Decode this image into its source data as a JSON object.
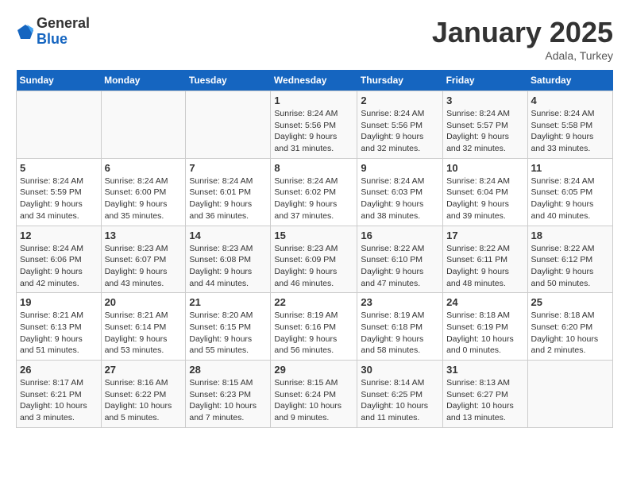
{
  "header": {
    "logo_general": "General",
    "logo_blue": "Blue",
    "month": "January 2025",
    "location": "Adala, Turkey"
  },
  "days_of_week": [
    "Sunday",
    "Monday",
    "Tuesday",
    "Wednesday",
    "Thursday",
    "Friday",
    "Saturday"
  ],
  "weeks": [
    [
      {
        "day": "",
        "info": ""
      },
      {
        "day": "",
        "info": ""
      },
      {
        "day": "",
        "info": ""
      },
      {
        "day": "1",
        "info": "Sunrise: 8:24 AM\nSunset: 5:56 PM\nDaylight: 9 hours\nand 31 minutes."
      },
      {
        "day": "2",
        "info": "Sunrise: 8:24 AM\nSunset: 5:56 PM\nDaylight: 9 hours\nand 32 minutes."
      },
      {
        "day": "3",
        "info": "Sunrise: 8:24 AM\nSunset: 5:57 PM\nDaylight: 9 hours\nand 32 minutes."
      },
      {
        "day": "4",
        "info": "Sunrise: 8:24 AM\nSunset: 5:58 PM\nDaylight: 9 hours\nand 33 minutes."
      }
    ],
    [
      {
        "day": "5",
        "info": "Sunrise: 8:24 AM\nSunset: 5:59 PM\nDaylight: 9 hours\nand 34 minutes."
      },
      {
        "day": "6",
        "info": "Sunrise: 8:24 AM\nSunset: 6:00 PM\nDaylight: 9 hours\nand 35 minutes."
      },
      {
        "day": "7",
        "info": "Sunrise: 8:24 AM\nSunset: 6:01 PM\nDaylight: 9 hours\nand 36 minutes."
      },
      {
        "day": "8",
        "info": "Sunrise: 8:24 AM\nSunset: 6:02 PM\nDaylight: 9 hours\nand 37 minutes."
      },
      {
        "day": "9",
        "info": "Sunrise: 8:24 AM\nSunset: 6:03 PM\nDaylight: 9 hours\nand 38 minutes."
      },
      {
        "day": "10",
        "info": "Sunrise: 8:24 AM\nSunset: 6:04 PM\nDaylight: 9 hours\nand 39 minutes."
      },
      {
        "day": "11",
        "info": "Sunrise: 8:24 AM\nSunset: 6:05 PM\nDaylight: 9 hours\nand 40 minutes."
      }
    ],
    [
      {
        "day": "12",
        "info": "Sunrise: 8:24 AM\nSunset: 6:06 PM\nDaylight: 9 hours\nand 42 minutes."
      },
      {
        "day": "13",
        "info": "Sunrise: 8:23 AM\nSunset: 6:07 PM\nDaylight: 9 hours\nand 43 minutes."
      },
      {
        "day": "14",
        "info": "Sunrise: 8:23 AM\nSunset: 6:08 PM\nDaylight: 9 hours\nand 44 minutes."
      },
      {
        "day": "15",
        "info": "Sunrise: 8:23 AM\nSunset: 6:09 PM\nDaylight: 9 hours\nand 46 minutes."
      },
      {
        "day": "16",
        "info": "Sunrise: 8:22 AM\nSunset: 6:10 PM\nDaylight: 9 hours\nand 47 minutes."
      },
      {
        "day": "17",
        "info": "Sunrise: 8:22 AM\nSunset: 6:11 PM\nDaylight: 9 hours\nand 48 minutes."
      },
      {
        "day": "18",
        "info": "Sunrise: 8:22 AM\nSunset: 6:12 PM\nDaylight: 9 hours\nand 50 minutes."
      }
    ],
    [
      {
        "day": "19",
        "info": "Sunrise: 8:21 AM\nSunset: 6:13 PM\nDaylight: 9 hours\nand 51 minutes."
      },
      {
        "day": "20",
        "info": "Sunrise: 8:21 AM\nSunset: 6:14 PM\nDaylight: 9 hours\nand 53 minutes."
      },
      {
        "day": "21",
        "info": "Sunrise: 8:20 AM\nSunset: 6:15 PM\nDaylight: 9 hours\nand 55 minutes."
      },
      {
        "day": "22",
        "info": "Sunrise: 8:19 AM\nSunset: 6:16 PM\nDaylight: 9 hours\nand 56 minutes."
      },
      {
        "day": "23",
        "info": "Sunrise: 8:19 AM\nSunset: 6:18 PM\nDaylight: 9 hours\nand 58 minutes."
      },
      {
        "day": "24",
        "info": "Sunrise: 8:18 AM\nSunset: 6:19 PM\nDaylight: 10 hours\nand 0 minutes."
      },
      {
        "day": "25",
        "info": "Sunrise: 8:18 AM\nSunset: 6:20 PM\nDaylight: 10 hours\nand 2 minutes."
      }
    ],
    [
      {
        "day": "26",
        "info": "Sunrise: 8:17 AM\nSunset: 6:21 PM\nDaylight: 10 hours\nand 3 minutes."
      },
      {
        "day": "27",
        "info": "Sunrise: 8:16 AM\nSunset: 6:22 PM\nDaylight: 10 hours\nand 5 minutes."
      },
      {
        "day": "28",
        "info": "Sunrise: 8:15 AM\nSunset: 6:23 PM\nDaylight: 10 hours\nand 7 minutes."
      },
      {
        "day": "29",
        "info": "Sunrise: 8:15 AM\nSunset: 6:24 PM\nDaylight: 10 hours\nand 9 minutes."
      },
      {
        "day": "30",
        "info": "Sunrise: 8:14 AM\nSunset: 6:25 PM\nDaylight: 10 hours\nand 11 minutes."
      },
      {
        "day": "31",
        "info": "Sunrise: 8:13 AM\nSunset: 6:27 PM\nDaylight: 10 hours\nand 13 minutes."
      },
      {
        "day": "",
        "info": ""
      }
    ]
  ]
}
